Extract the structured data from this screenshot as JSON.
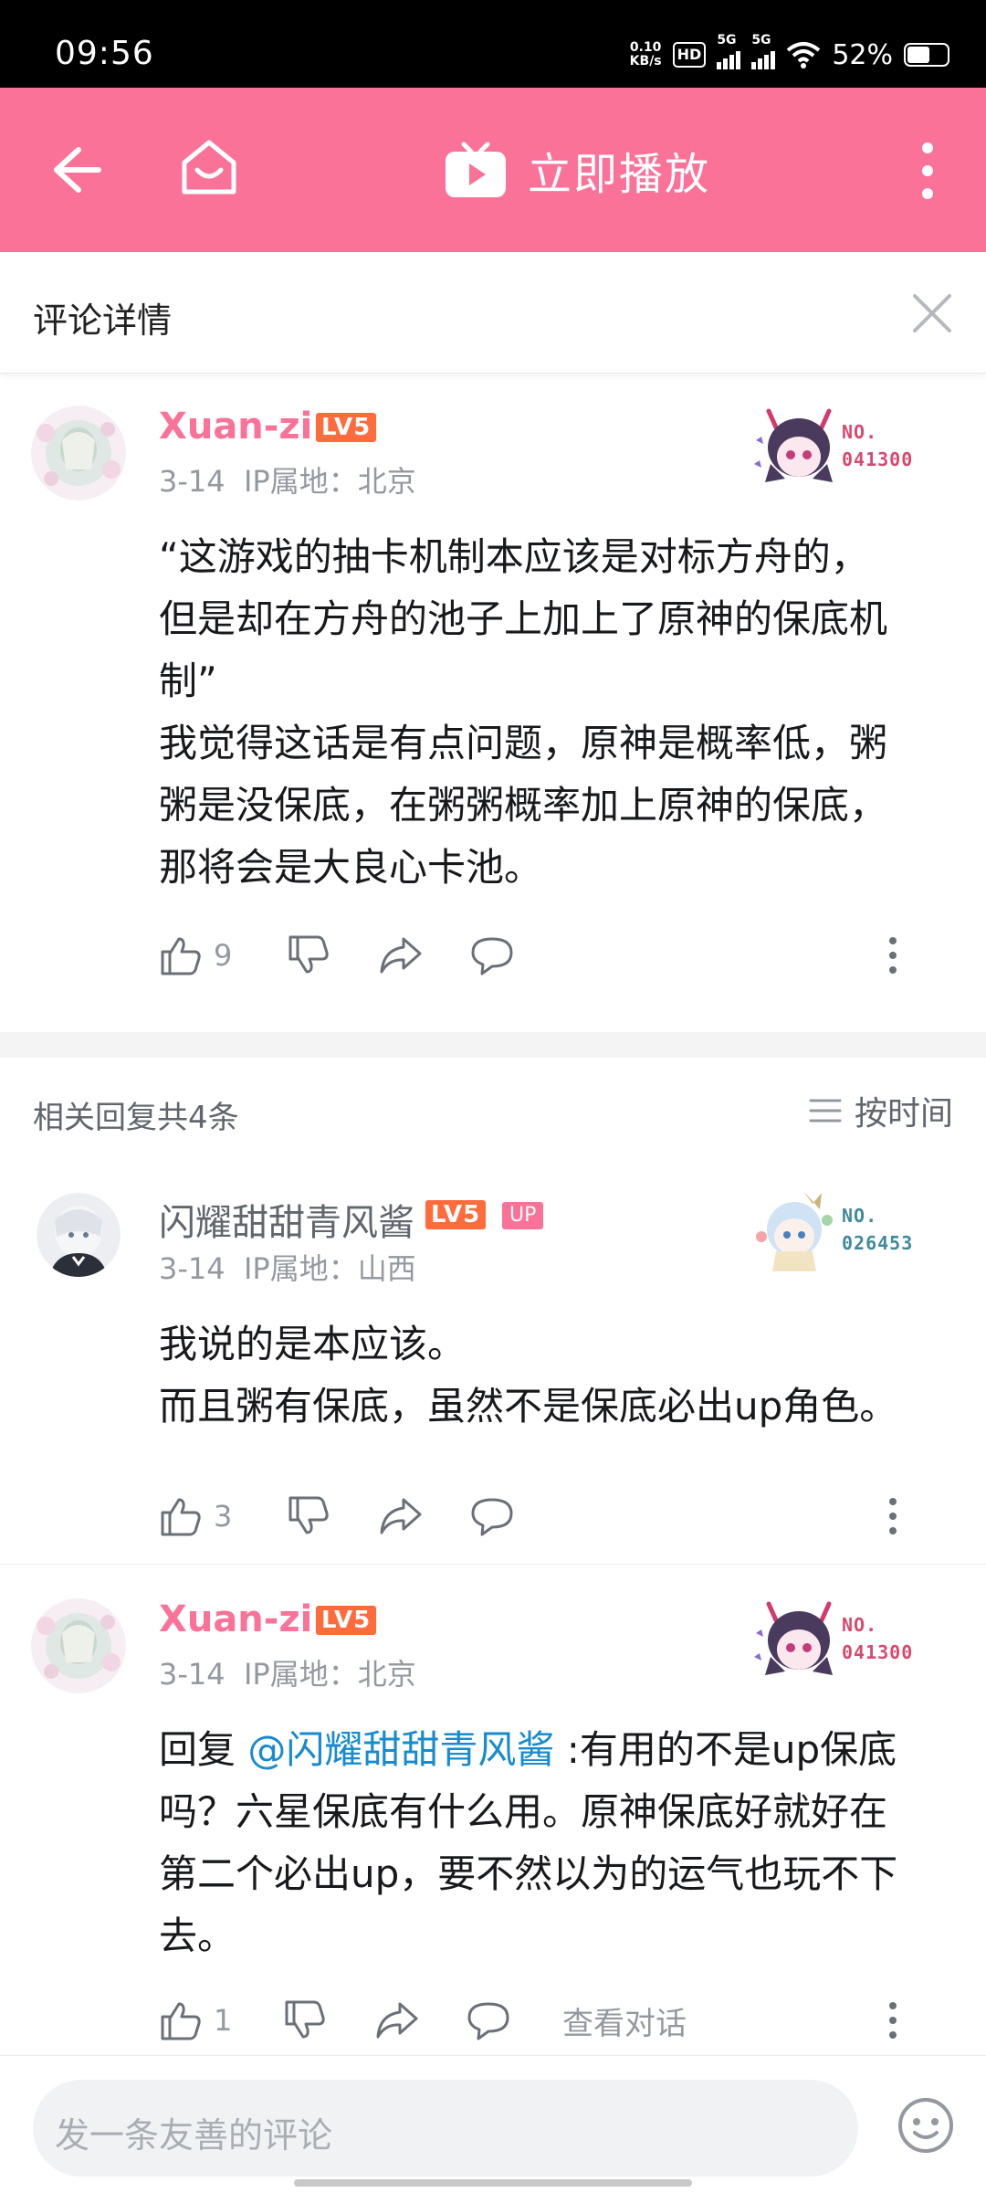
{
  "status_bar": {
    "time": "09:56",
    "net_speed_value": "0.10",
    "net_speed_unit": "KB/s",
    "hd_label": "HD",
    "signal1": "5G",
    "signal2": "5G",
    "battery": "52%",
    "battery_level": 0.52
  },
  "top_bar": {
    "play_label": "立即播放",
    "accent": "#fb7299",
    "icons": [
      "back-arrow-icon",
      "home-icon",
      "tv-play-icon",
      "more-vertical-icon"
    ]
  },
  "detail_header": {
    "title": "评论详情"
  },
  "main_comment": {
    "username": "Xuan-zi",
    "level": "LV5",
    "date": "3-14",
    "ip": "IP属地：北京",
    "fan_badge_no": "NO.",
    "fan_badge_id": "041300",
    "content": "“这游戏的抽卡机制本应该是对标方舟的，\n但是却在方舟的池子上加上了原神的保底机\n制”\n我觉得这话是有点问题，原神是概率低，粥\n粥是没保底，在粥粥概率加上原神的保底，\n那将会是大良心卡池。",
    "likes": "9"
  },
  "replies_header": {
    "count_label": "相关回复共4条",
    "sort_label": "按时间"
  },
  "replies": [
    {
      "username": "闪耀甜甜青风酱",
      "level": "LV5",
      "up_badge": "UP",
      "date": "3-14",
      "ip": "IP属地：山西",
      "fan_badge_no": "NO.",
      "fan_badge_id": "026453",
      "content": "我说的是本应该。\n而且粥有保底，虽然不是保底必出up角色。",
      "likes": "3"
    },
    {
      "username": "Xuan-zi",
      "level": "LV5",
      "date": "3-14",
      "ip": "IP属地：北京",
      "fan_badge_no": "NO.",
      "fan_badge_id": "041300",
      "reply_prefix": "回复 ",
      "mention": "@闪耀甜甜青风酱",
      "content": " :有用的不是up保底\n吗？六星保底有什么用。原神保底好就好在\n第二个必出up，要不然以为的运气也玩不下\n去。",
      "likes": "1",
      "view_conversation": "查看对话"
    }
  ],
  "input_bar": {
    "placeholder": "发一条友善的评论"
  }
}
